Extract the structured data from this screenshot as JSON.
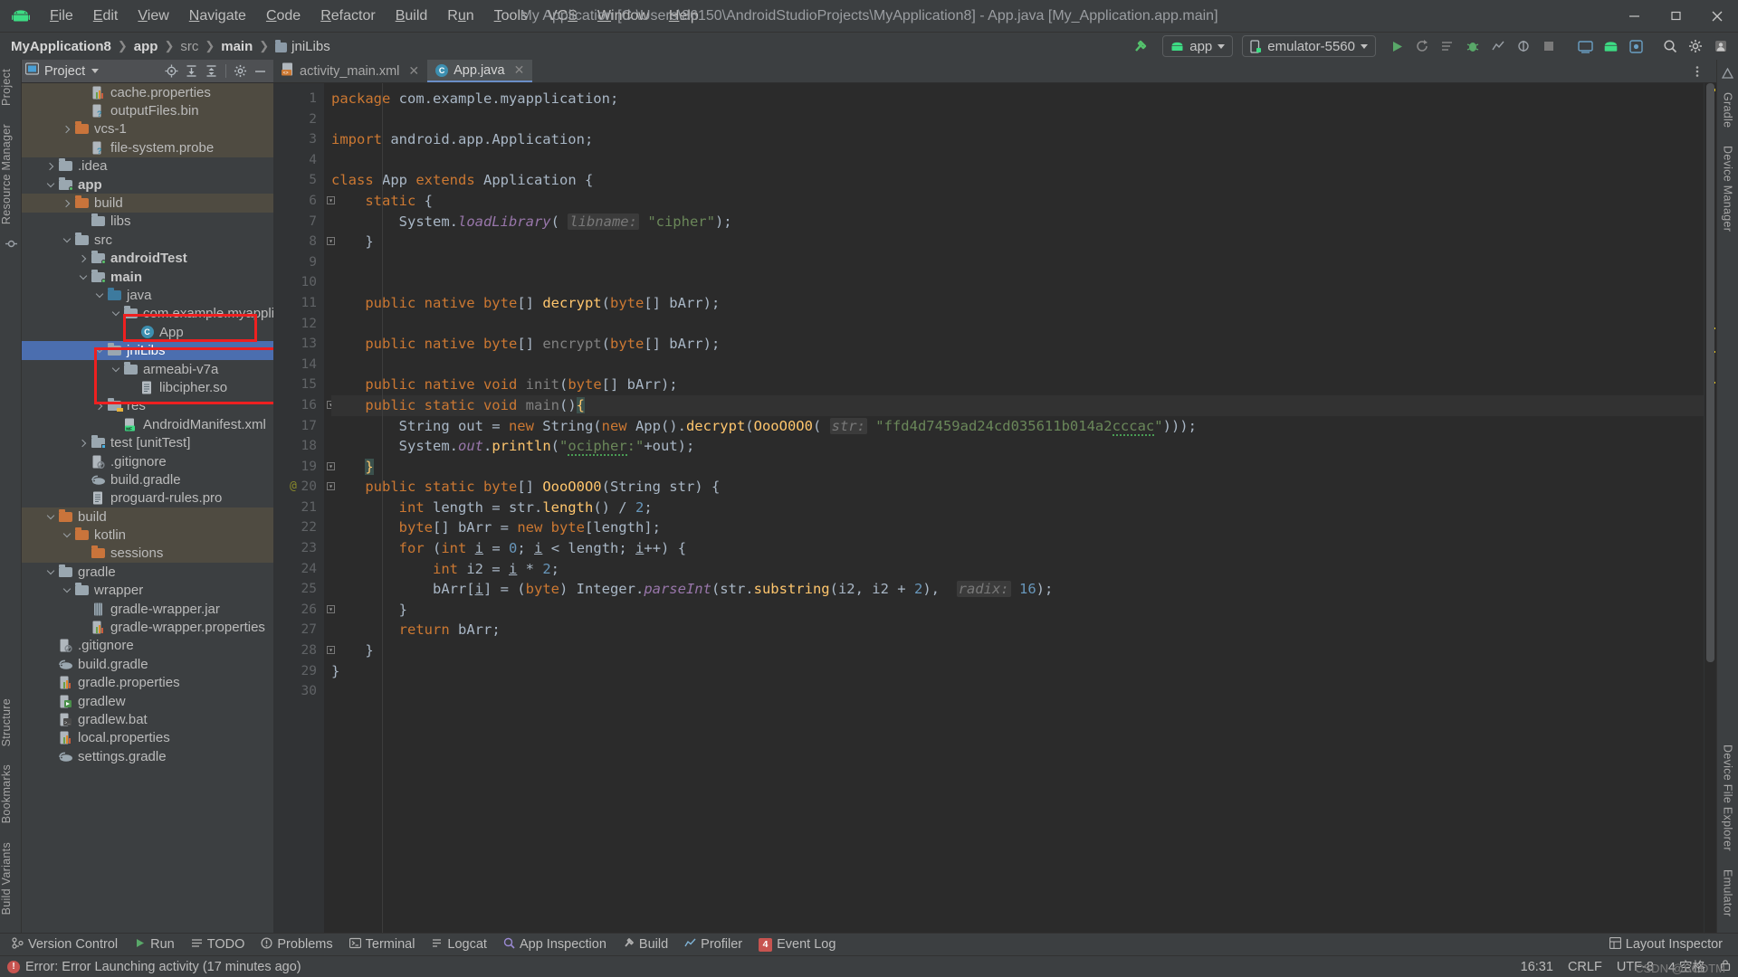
{
  "window": {
    "title": "My Application [C:\\Users\\86150\\AndroidStudioProjects\\MyApplication8] - App.java [My_Application.app.main]",
    "minimize": "—",
    "maximize": "❐",
    "close": "✕"
  },
  "menu": [
    {
      "label": "File"
    },
    {
      "label": "Edit"
    },
    {
      "label": "View"
    },
    {
      "label": "Navigate"
    },
    {
      "label": "Code"
    },
    {
      "label": "Refactor"
    },
    {
      "label": "Build"
    },
    {
      "label": "Run"
    },
    {
      "label": "Tools"
    },
    {
      "label": "VCS"
    },
    {
      "label": "Window"
    },
    {
      "label": "Help"
    }
  ],
  "breadcrumb": [
    {
      "label": "MyApplication8",
      "style": "bold"
    },
    {
      "label": "app",
      "style": "bold"
    },
    {
      "label": "src",
      "style": "dim"
    },
    {
      "label": "main",
      "style": "bold"
    },
    {
      "label": "jniLibs",
      "style": "folder"
    }
  ],
  "toolbar": {
    "run_config": "app",
    "device": "emulator-5560",
    "make_icon": "hammer-icon",
    "run_icon": "run-icon",
    "debug_icon": "debug-icon"
  },
  "project_panel": {
    "title": "Project",
    "tree": [
      {
        "indent": 3,
        "twisty": "none",
        "icon": "properties-file",
        "label": "cache.properties",
        "row": "hl"
      },
      {
        "indent": 3,
        "twisty": "none",
        "icon": "unknown-file",
        "label": "outputFiles.bin",
        "row": "hl"
      },
      {
        "indent": 2,
        "twisty": "right",
        "icon": "folder-orange",
        "label": "vcs-1",
        "row": "hl"
      },
      {
        "indent": 3,
        "twisty": "none",
        "icon": "unknown-file",
        "label": "file-system.probe",
        "row": "hl"
      },
      {
        "indent": 1,
        "twisty": "right",
        "icon": "folder-gray",
        "label": ".idea",
        "row": "normal"
      },
      {
        "indent": 1,
        "twisty": "down",
        "icon": "folder-module",
        "label": "app",
        "bold": true,
        "row": "normal"
      },
      {
        "indent": 2,
        "twisty": "right",
        "icon": "folder-orange",
        "label": "build",
        "row": "hl"
      },
      {
        "indent": 3,
        "twisty": "none",
        "icon": "folder-gray",
        "label": "libs",
        "row": "normal"
      },
      {
        "indent": 2,
        "twisty": "down",
        "icon": "folder-gray",
        "label": "src",
        "row": "normal"
      },
      {
        "indent": 3,
        "twisty": "right",
        "icon": "folder-module",
        "label": "androidTest",
        "bold": true,
        "row": "normal"
      },
      {
        "indent": 3,
        "twisty": "down",
        "icon": "folder-module",
        "label": "main",
        "bold": true,
        "row": "normal"
      },
      {
        "indent": 4,
        "twisty": "down",
        "icon": "folder-blue",
        "label": "java",
        "row": "normal"
      },
      {
        "indent": 5,
        "twisty": "down",
        "icon": "folder-gray",
        "label": "com.example.myapplica",
        "row": "normal"
      },
      {
        "indent": 6,
        "twisty": "none",
        "icon": "java-class",
        "label": "App",
        "row": "normal"
      },
      {
        "indent": 4,
        "twisty": "down",
        "icon": "folder-gray",
        "label": "jniLibs",
        "row": "sel"
      },
      {
        "indent": 5,
        "twisty": "down",
        "icon": "folder-gray",
        "label": "armeabi-v7a",
        "row": "normal"
      },
      {
        "indent": 6,
        "twisty": "none",
        "icon": "so-file",
        "label": "libcipher.so",
        "row": "normal"
      },
      {
        "indent": 4,
        "twisty": "right",
        "icon": "folder-res",
        "label": "res",
        "row": "normal"
      },
      {
        "indent": 5,
        "twisty": "none",
        "icon": "manifest-file",
        "label": "AndroidManifest.xml",
        "row": "normal"
      },
      {
        "indent": 3,
        "twisty": "right",
        "icon": "folder-test",
        "label": "test [unitTest]",
        "row": "normal"
      },
      {
        "indent": 3,
        "twisty": "none",
        "icon": "gitignore-file",
        "label": ".gitignore",
        "row": "normal"
      },
      {
        "indent": 3,
        "twisty": "none",
        "icon": "gradle-file",
        "label": "build.gradle",
        "row": "normal"
      },
      {
        "indent": 3,
        "twisty": "none",
        "icon": "pro-file",
        "label": "proguard-rules.pro",
        "row": "normal"
      },
      {
        "indent": 1,
        "twisty": "down",
        "icon": "folder-orange",
        "label": "build",
        "row": "hl"
      },
      {
        "indent": 2,
        "twisty": "down",
        "icon": "folder-orange",
        "label": "kotlin",
        "row": "hl"
      },
      {
        "indent": 3,
        "twisty": "none",
        "icon": "folder-orange",
        "label": "sessions",
        "row": "hl"
      },
      {
        "indent": 1,
        "twisty": "down",
        "icon": "folder-gray",
        "label": "gradle",
        "row": "normal"
      },
      {
        "indent": 2,
        "twisty": "down",
        "icon": "folder-gray",
        "label": "wrapper",
        "row": "normal"
      },
      {
        "indent": 3,
        "twisty": "none",
        "icon": "jar-file",
        "label": "gradle-wrapper.jar",
        "row": "normal"
      },
      {
        "indent": 3,
        "twisty": "none",
        "icon": "properties-file",
        "label": "gradle-wrapper.properties",
        "row": "normal"
      },
      {
        "indent": 1,
        "twisty": "none",
        "icon": "gitignore-file",
        "label": ".gitignore",
        "row": "normal"
      },
      {
        "indent": 1,
        "twisty": "none",
        "icon": "gradle-file",
        "label": "build.gradle",
        "row": "normal"
      },
      {
        "indent": 1,
        "twisty": "none",
        "icon": "properties-file",
        "label": "gradle.properties",
        "row": "normal"
      },
      {
        "indent": 1,
        "twisty": "none",
        "icon": "gradlew-file",
        "label": "gradlew",
        "row": "normal"
      },
      {
        "indent": 1,
        "twisty": "none",
        "icon": "bat-file",
        "label": "gradlew.bat",
        "row": "normal"
      },
      {
        "indent": 1,
        "twisty": "none",
        "icon": "properties-file",
        "label": "local.properties",
        "row": "normal"
      },
      {
        "indent": 1,
        "twisty": "none",
        "icon": "gradle-file",
        "label": "settings.gradle",
        "row": "normal"
      }
    ]
  },
  "left_rail": [
    {
      "label": "Project",
      "name": "rail-project"
    },
    {
      "label": "Resource Manager",
      "name": "rail-resource-manager"
    },
    {
      "label": "Structure",
      "name": "rail-structure"
    },
    {
      "label": "Bookmarks",
      "name": "rail-bookmarks"
    },
    {
      "label": "Build Variants",
      "name": "rail-build-variants"
    }
  ],
  "right_rail": [
    {
      "label": "Gradle",
      "name": "rail-gradle"
    },
    {
      "label": "Device Manager",
      "name": "rail-device-manager"
    },
    {
      "label": "Device File Explorer",
      "name": "rail-device-file-explorer"
    },
    {
      "label": "Emulator",
      "name": "rail-emulator"
    }
  ],
  "editor": {
    "tabs": [
      {
        "label": "activity_main.xml",
        "icon": "xml-file-icon",
        "active": false
      },
      {
        "label": "App.java",
        "icon": "java-class-icon",
        "active": true
      }
    ],
    "lines": [
      {
        "n": 1,
        "html": "<span class='kw'>package</span> com.example.myapplication;"
      },
      {
        "n": 2,
        "html": ""
      },
      {
        "n": 3,
        "html": "<span class='kw'>import</span> android.app.Application;"
      },
      {
        "n": 4,
        "html": ""
      },
      {
        "n": 5,
        "html": "<span class='kw'>class</span> App <span class='kw'>extends</span> Application {"
      },
      {
        "n": 6,
        "html": "    <span class='kw'>static</span> {",
        "fold": true
      },
      {
        "n": 7,
        "html": "        System.<span class='sfield'>loadLibrary</span>( <span class='hint'>libname:</span> <span class='str'>\"cipher\"</span>);"
      },
      {
        "n": 8,
        "html": "    }",
        "fold": true
      },
      {
        "n": 9,
        "html": ""
      },
      {
        "n": 10,
        "html": ""
      },
      {
        "n": 11,
        "html": "    <span class='kw'>public native byte</span>[] <span class='mth'>decrypt</span>(<span class='kw'>byte</span>[] bArr);"
      },
      {
        "n": 12,
        "html": ""
      },
      {
        "n": 13,
        "html": "    <span class='kw'>public native byte</span>[] <span class='gray'>encrypt</span>(<span class='kw'>byte</span>[] bArr);"
      },
      {
        "n": 14,
        "html": ""
      },
      {
        "n": 15,
        "html": "    <span class='kw'>public native void</span> <span class='gray'>init</span>(<span class='kw'>byte</span>[] bArr);"
      },
      {
        "n": 16,
        "html": "    <span class='kw'>public static void</span> <span class='gray'>main</span>()<span class='brmatch'>{</span>",
        "cur": true,
        "fold": true
      },
      {
        "n": 17,
        "html": "        String out = <span class='kw'>new</span> String(<span class='kw'>new</span> App().<span class='mth'>decrypt</span>(<span class='mth'>OooO0O0</span>( <span class='hint'>str:</span> <span class='str'>\"ffd4d7459ad24cd035611b014a2</span><span class='str wavy'>cccac</span><span class='str'>\"</span>)));"
      },
      {
        "n": 18,
        "html": "        System.<span class='sfield'>out</span>.<span class='mth'>println</span>(<span class='str'>\"</span><span class='str wavy'>ocipher</span><span class='str'>:\"</span>+out);"
      },
      {
        "n": 19,
        "html": "    <span class='brmatch'>}</span>",
        "fold": true
      },
      {
        "n": 20,
        "html": "    <span class='kw'>public static byte</span>[] <span class='mth'>OooO0O0</span>(String str) {",
        "at": "@",
        "fold": true
      },
      {
        "n": 21,
        "html": "        <span class='kw'>int</span> length = str.<span class='mth'>length</span>() / <span class='num'>2</span>;"
      },
      {
        "n": 22,
        "html": "        <span class='kw'>byte</span>[] bArr = <span class='kw'>new byte</span>[length];"
      },
      {
        "n": 23,
        "html": "        <span class='kw'>for</span> (<span class='kw'>int</span> <u>i</u> = <span class='num'>0</span>; <u>i</u> &lt; length; <u>i</u>++) {"
      },
      {
        "n": 24,
        "html": "            <span class='kw'>int</span> i2 = <u>i</u> * <span class='num'>2</span>;"
      },
      {
        "n": 25,
        "html": "            bArr[<u>i</u>] = (<span class='kw'>byte</span>) Integer.<span class='sfield'>parseInt</span>(str.<span class='mth'>substring</span>(i2, i2 + <span class='num'>2</span>),  <span class='hint'>radix:</span> <span class='num'>16</span>);"
      },
      {
        "n": 26,
        "html": "        }",
        "fold": true
      },
      {
        "n": 27,
        "html": "        <span class='kw'>return</span> bArr;"
      },
      {
        "n": 28,
        "html": "    }",
        "fold": true
      },
      {
        "n": 29,
        "html": "}"
      },
      {
        "n": 30,
        "html": ""
      }
    ]
  },
  "tool_windows": [
    {
      "label": "Version Control",
      "icon": "branch-icon"
    },
    {
      "label": "Run",
      "icon": "run-icon"
    },
    {
      "label": "TODO",
      "icon": "todo-icon"
    },
    {
      "label": "Problems",
      "icon": "problems-icon"
    },
    {
      "label": "Terminal",
      "icon": "terminal-icon"
    },
    {
      "label": "Logcat",
      "icon": "logcat-icon"
    },
    {
      "label": "App Inspection",
      "icon": "inspection-icon"
    },
    {
      "label": "Build",
      "icon": "hammer-icon"
    },
    {
      "label": "Profiler",
      "icon": "profiler-icon"
    },
    {
      "label": "Event Log",
      "icon": "event-log-icon",
      "badge": "4"
    }
  ],
  "tool_windows_right": {
    "label": "Layout Inspector",
    "icon": "layout-inspector-icon"
  },
  "statusbar": {
    "error_text": "Error: Error Launching activity (17 minutes ago)",
    "error_icon": "error-icon",
    "time": "16:31",
    "line_sep": "CRLF",
    "encoding": "UTF-8",
    "indent": "4 空格",
    "watermark": "CSDN @SCDTM"
  },
  "colors": {
    "accent_blue": "#4b6eaf",
    "annotation_red": "#ee2020",
    "highlight_tan": "#4f4b41",
    "editor_bg": "#2b2b2b",
    "chrome_bg": "#3c3f41"
  }
}
